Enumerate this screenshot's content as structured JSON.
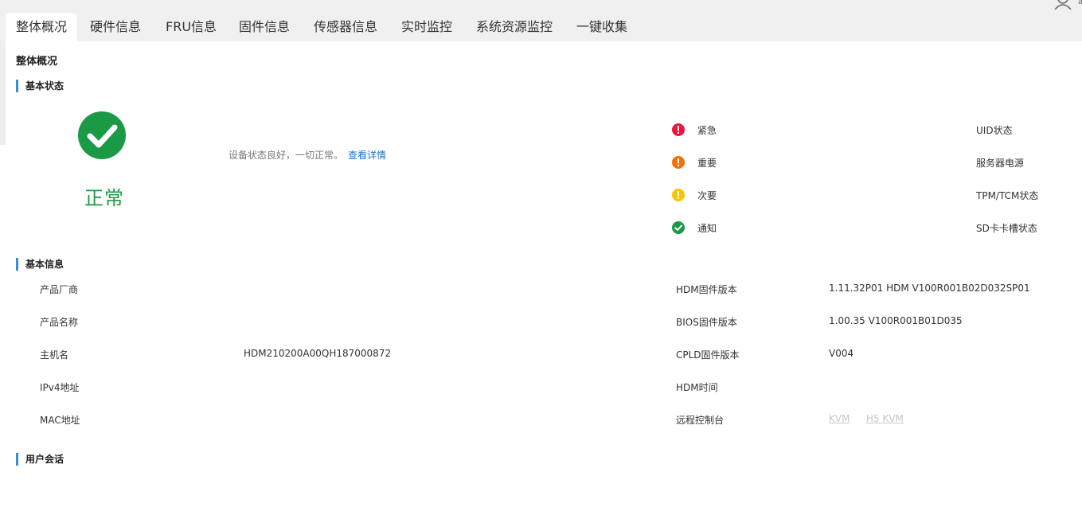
{
  "tabs": [
    {
      "label": "整体概况",
      "active": true
    },
    {
      "label": "硬件信息"
    },
    {
      "label": "FRU信息"
    },
    {
      "label": "固件信息"
    },
    {
      "label": "传感器信息"
    },
    {
      "label": "实时监控"
    },
    {
      "label": "系统资源监控"
    },
    {
      "label": "一键收集"
    }
  ],
  "header": {
    "user_icon": "user-icon",
    "user_extra": "a"
  },
  "page": {
    "title": "整体概况"
  },
  "basic_status": {
    "section_title": "基本状态",
    "status_icon": "check-circle-icon",
    "status_text": "正常",
    "description": "设备状态良好，一切正常。",
    "detail_link": "查看详情",
    "alarms": [
      {
        "label": "紧急",
        "icon": "critical-alert-icon",
        "color": "#e8173b"
      },
      {
        "label": "重要",
        "icon": "major-alert-icon",
        "color": "#f2700a"
      },
      {
        "label": "次要",
        "icon": "minor-alert-icon",
        "color": "#f7c40a"
      },
      {
        "label": "通知",
        "icon": "notice-check-icon",
        "color": "#1b9a46"
      }
    ],
    "right_items": [
      "UID状态",
      "服务器电源",
      "TPM/TCM状态",
      "SD卡卡槽状态"
    ]
  },
  "basic_info": {
    "section_title": "基本信息",
    "left": [
      {
        "label": "产品厂商",
        "value": ""
      },
      {
        "label": "产品名称",
        "value": ""
      },
      {
        "label": "主机名",
        "value": "HDM210200A00QH187000872"
      },
      {
        "label": "IPv4地址",
        "value": ""
      },
      {
        "label": "MAC地址",
        "value": ""
      }
    ],
    "right": [
      {
        "label": "HDM固件版本",
        "value": "1.11.32P01 HDM V100R001B02D032SP01"
      },
      {
        "label": "BIOS固件版本",
        "value": "1.00.35 V100R001B01D035"
      },
      {
        "label": "CPLD固件版本",
        "value": "V004"
      },
      {
        "label": "HDM时间",
        "value": ""
      },
      {
        "label": "远程控制台",
        "value": ""
      }
    ],
    "console_links": [
      "KVM",
      "H5 KVM"
    ]
  },
  "user_session": {
    "section_title": "用户会话"
  },
  "colors": {
    "accent": "#3b8cde",
    "ok": "#1b9a46",
    "link": "#1f73c5",
    "disabled": "#c6c6c6"
  }
}
